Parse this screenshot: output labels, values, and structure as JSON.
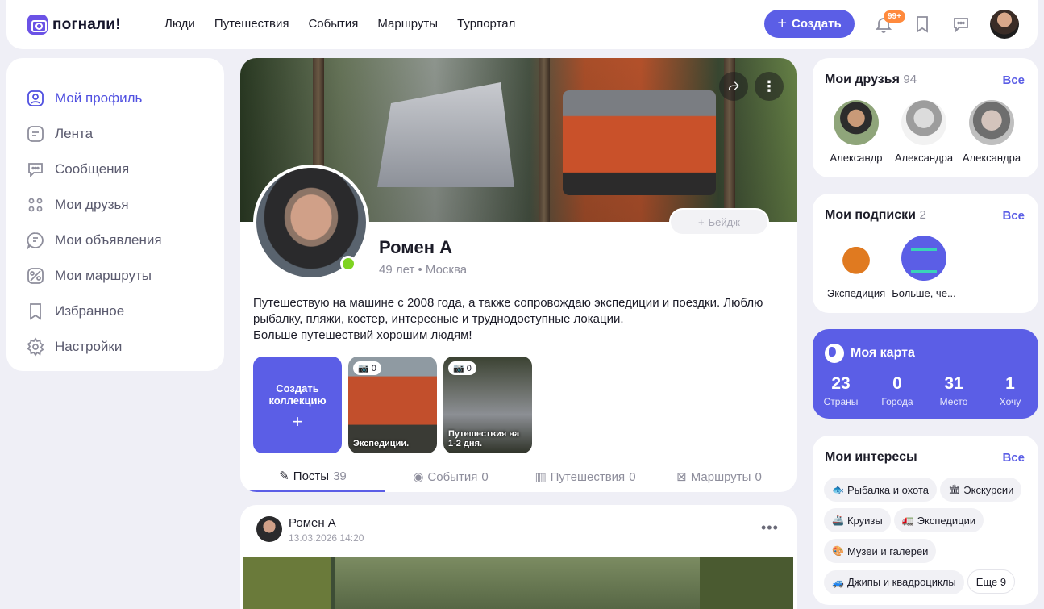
{
  "brand": {
    "name": "погнали!"
  },
  "nav": [
    "Люди",
    "Путешествия",
    "События",
    "Маршруты",
    "Турпортал"
  ],
  "header": {
    "create_label": "Создать",
    "notif_badge": "99+"
  },
  "sidebar": {
    "items": [
      {
        "label": "Мой профиль",
        "icon": "user-icon"
      },
      {
        "label": "Лента",
        "icon": "feed-icon"
      },
      {
        "label": "Сообщения",
        "icon": "chat-icon"
      },
      {
        "label": "Мои друзья",
        "icon": "friends-icon"
      },
      {
        "label": "Мои объявления",
        "icon": "ads-icon"
      },
      {
        "label": "Мои маршруты",
        "icon": "route-icon"
      },
      {
        "label": "Избранное",
        "icon": "bookmark-icon"
      },
      {
        "label": "Настройки",
        "icon": "gear-icon"
      }
    ]
  },
  "profile": {
    "name": "Ромен А",
    "age": "49 лет",
    "city": "Москва",
    "badge_label": "Бейдж",
    "bio_lines": [
      "Путешествую на машине с 2008 года, а также сопровождаю экспедиции и поездки. Люблю рыбалку, пляжи, костер, интересные и труднодоступные локации.",
      "Больше путешествий хорошим людям!"
    ],
    "collections": {
      "create_label_1": "Создать",
      "create_label_2": "коллекцию",
      "items": [
        {
          "title": "Экспедиции.",
          "count": "0"
        },
        {
          "title": "Путешествия на 1-2 дня.",
          "count": "0"
        }
      ]
    },
    "tabs": [
      {
        "label": "Посты",
        "count": "39"
      },
      {
        "label": "События",
        "count": "0"
      },
      {
        "label": "Путешествия",
        "count": "0"
      },
      {
        "label": "Маршруты",
        "count": "0"
      }
    ]
  },
  "post": {
    "author": "Ромен А",
    "date": "13.03.2026 14:20"
  },
  "friends": {
    "title": "Мои друзья",
    "count": "94",
    "all": "Все",
    "items": [
      "Александр",
      "Александра",
      "Александра"
    ]
  },
  "subscriptions": {
    "title": "Мои подписки",
    "count": "2",
    "all": "Все",
    "items": [
      "Экспедиция",
      "Больше, че..."
    ]
  },
  "map": {
    "title": "Моя карта",
    "stats": [
      {
        "value": "23",
        "label": "Страны"
      },
      {
        "value": "0",
        "label": "Города"
      },
      {
        "value": "31",
        "label": "Место"
      },
      {
        "value": "1",
        "label": "Хочу"
      }
    ]
  },
  "interests": {
    "title": "Мои интересы",
    "all": "Все",
    "items": [
      {
        "label": "Рыбалка и охота",
        "emoji": "🐟"
      },
      {
        "label": "Экскурсии",
        "emoji": "🏛"
      },
      {
        "label": "Круизы",
        "emoji": "🚢"
      },
      {
        "label": "Экспедиции",
        "emoji": "🚛"
      },
      {
        "label": "Музеи и галереи",
        "emoji": "🎨"
      },
      {
        "label": "Джипы и квадроциклы",
        "emoji": "🚙"
      }
    ],
    "more": "Еще 9"
  },
  "colors": {
    "accent": "#5b5ee6",
    "online": "#7ed321",
    "badge": "#ff8a3d"
  }
}
